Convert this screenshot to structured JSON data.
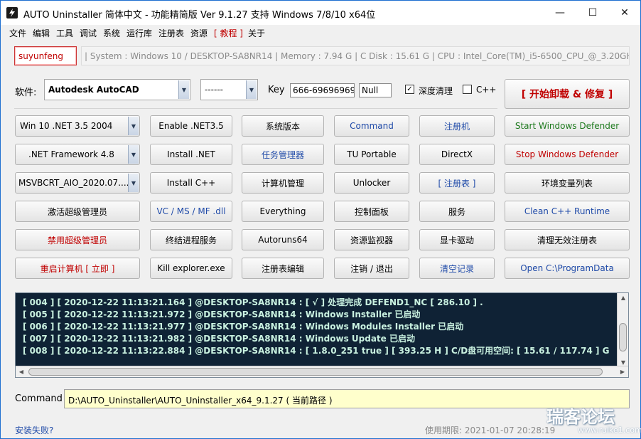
{
  "window": {
    "title": "AUTO Uninstaller 简体中文 - 功能精简版 Ver 9.1.27 支持 Windows 7/8/10 x64位",
    "minimize": "—",
    "maximize": "☐",
    "close": "✕"
  },
  "menu": [
    "文件",
    "编辑",
    "工具",
    "调试",
    "系统",
    "运行库",
    "注册表",
    "资源",
    "[ 教程 ]",
    "关于"
  ],
  "user": "suyunfeng",
  "sysinfo": "| System : Windows 10  /  DESKTOP-SA8NR14  |  Memory : 7.94 G |  C Disk : 15.61 G  |  CPU : Intel_Core(TM)_i5-6500_CPU_@_3.20GHz  |",
  "software": {
    "label": "软件:",
    "selected": "Autodesk AutoCAD",
    "version": "------",
    "key_label": "Key",
    "key_value": "666-69696969",
    "key_extra": "Null",
    "deep_clean_label": "深度清理",
    "deep_clean_checked": "✓",
    "cpp_label": "C++",
    "cpp_checked": ""
  },
  "start_button": "[ 开始卸载 & 修复 ]",
  "buttons": {
    "row1": [
      "Win 10 .NET 3.5 2004",
      "Enable .NET3.5",
      "系统版本",
      "Command",
      "注册机",
      "Start  Windows Defender"
    ],
    "row2": [
      ".NET Framework 4.8",
      "Install .NET",
      "任务管理器",
      "TU Portable",
      "DirectX",
      "Stop  Windows Defender"
    ],
    "row3": [
      "MSVBCRT_AIO_2020.07....",
      "Install C++",
      "计算机管理",
      "Unlocker",
      "[ 注册表 ]",
      "环境变量列表"
    ],
    "row4": [
      "激活超级管理员",
      "VC / MS / MF .dll",
      "Everything",
      "控制面板",
      "服务",
      "Clean C++ Runtime"
    ],
    "row5": [
      "禁用超级管理员",
      "终结进程服务",
      "Autoruns64",
      "资源监视器",
      "显卡驱动",
      "清理无效注册表"
    ],
    "row6": [
      "重启计算机 [ 立即 ]",
      "Kill explorer.exe",
      "注册表编辑",
      "注销 / 退出",
      "清空记录",
      "Open C:\\ProgramData"
    ]
  },
  "log": [
    "[ 004 ] [ 2020-12-22 11:13:21.164 ] @DESKTOP-SA8NR14 : [ √ ] 处理完成 DEFEND1_NC [ 286.10 ] .",
    "[ 005 ] [ 2020-12-22 11:13:21.972 ] @DESKTOP-SA8NR14 : Windows Installer 已启动",
    "[ 006 ] [ 2020-12-22 11:13:21.977 ] @DESKTOP-SA8NR14 : Windows Modules Installer 已启动",
    "[ 007 ] [ 2020-12-22 11:13:21.982 ] @DESKTOP-SA8NR14 : Windows Update 已启动",
    "[ 008 ] [ 2020-12-22 11:13:22.884 ] @DESKTOP-SA8NR14 : [ 1.8.0_251 true ] [ 393.25 H ] C/D盘可用空间: [ 15.61 / 117.74 ] G"
  ],
  "command": {
    "label": "Command",
    "value": "D:\\AUTO_Uninstaller\\AUTO_Uninstaller_x64_9.1.27 ( 当前路径 )"
  },
  "status": {
    "left": "安装失败?",
    "right": "使用期限: 2021-01-07 20:28:19"
  },
  "watermark": {
    "main": "瑞客论坛",
    "sub": "www.ruike1.com"
  },
  "colors": {
    "accent_blue": "#1f4aa8",
    "accent_red": "#c00000",
    "accent_green": "#1e7a1e",
    "log_bg": "#0f2235",
    "command_bg": "#ffffcc"
  }
}
